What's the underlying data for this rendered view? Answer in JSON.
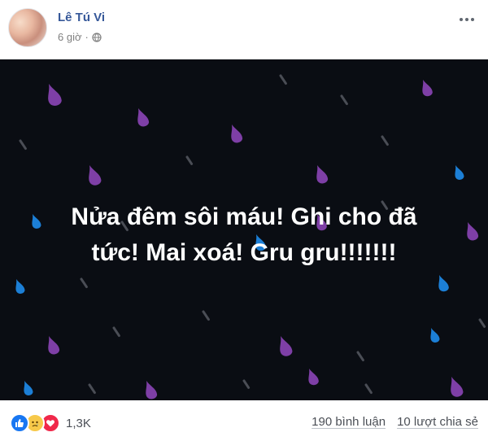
{
  "post": {
    "author": "Lê Tú Vi",
    "time": "6 giờ",
    "privacy_icon": "globe-icon",
    "menu_icon": "more-icon"
  },
  "art": {
    "text_line1": "Nửa đêm sôi máu! Ghi cho đã",
    "text_line2": "tức! Mai xoá! Gru gru!!!!!!!",
    "background": "#0a0d13",
    "drop_colors": [
      "#7e3fa6",
      "#1c7fd6",
      "#4a4d55"
    ]
  },
  "footer": {
    "reactions": [
      "like-icon",
      "sad-icon",
      "love-icon"
    ],
    "reaction_count": "1,3K",
    "comments": "190 bình luận",
    "shares": "10 lượt chia sẻ"
  }
}
